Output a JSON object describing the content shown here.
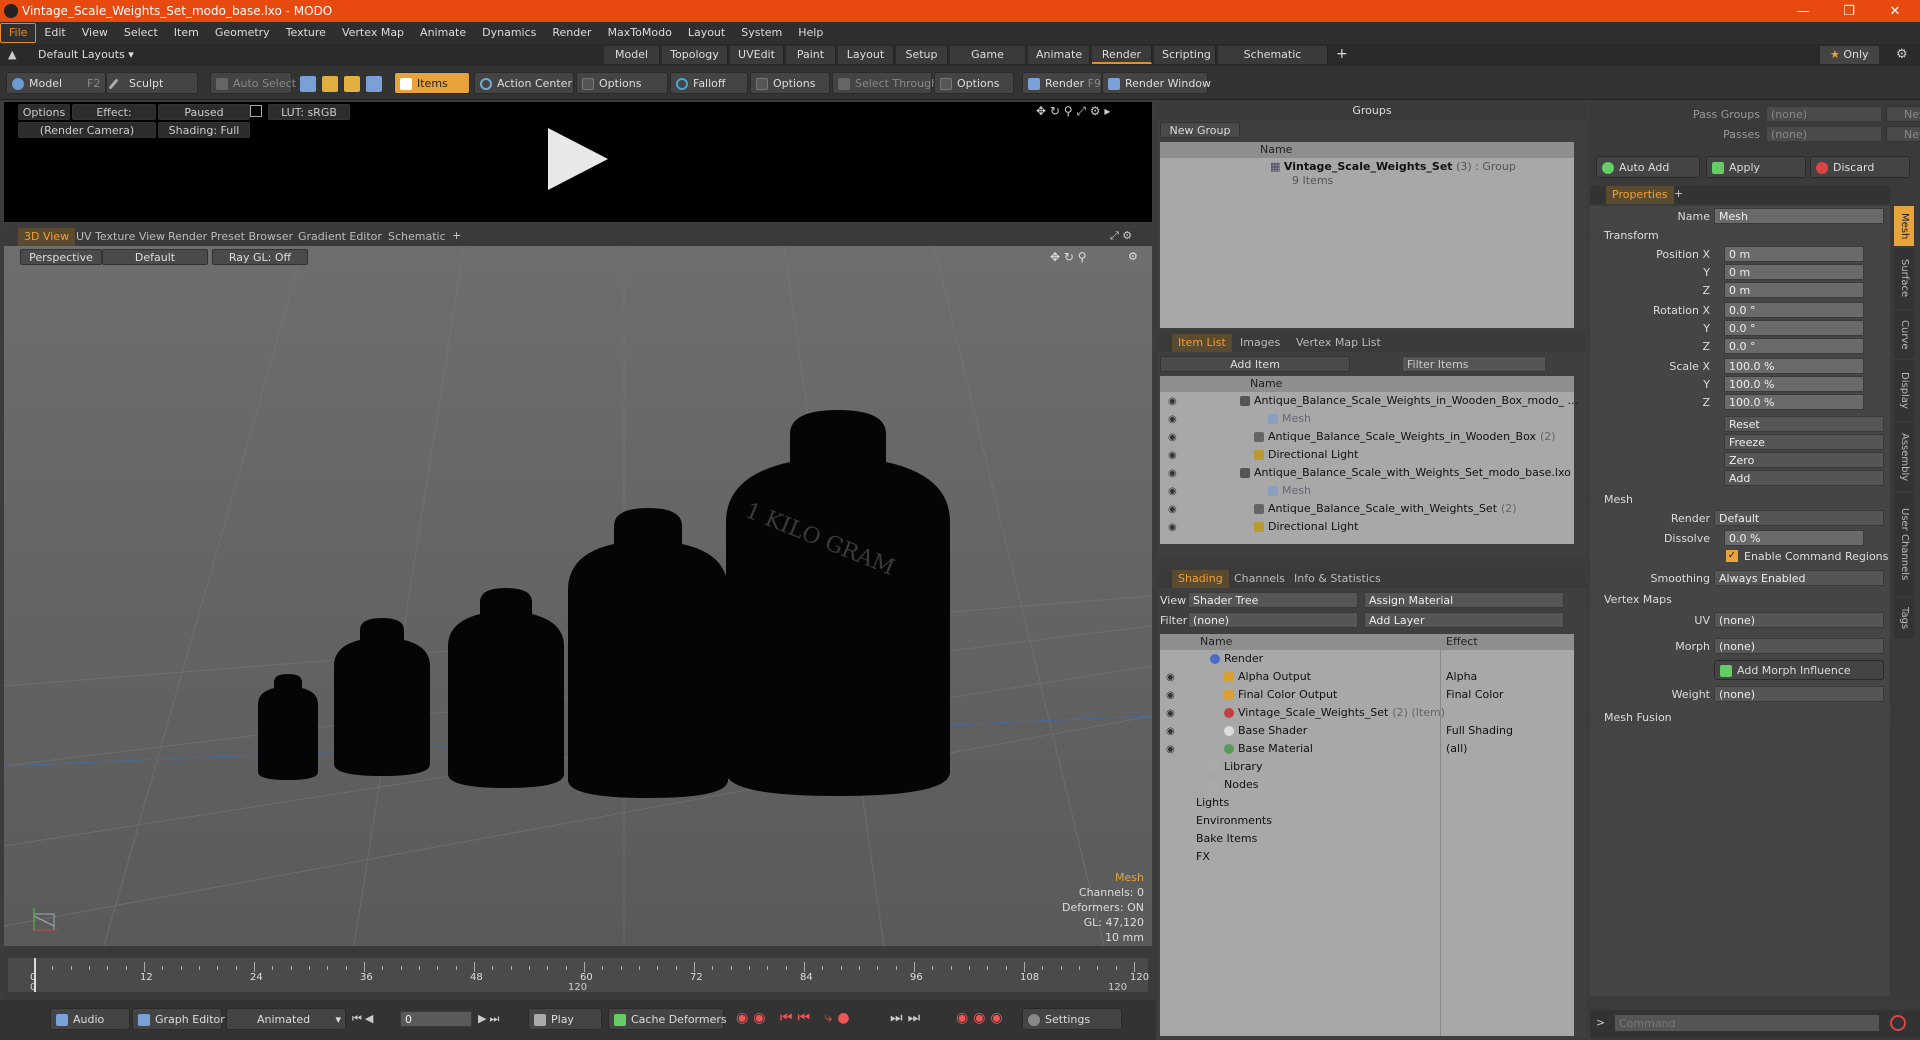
{
  "window": {
    "title": "Vintage_Scale_Weights_Set_modo_base.lxo - MODO"
  },
  "menu": [
    "File",
    "Edit",
    "View",
    "Select",
    "Item",
    "Geometry",
    "Texture",
    "Vertex Map",
    "Animate",
    "Dynamics",
    "Render",
    "MaxToModo",
    "Layout",
    "System",
    "Help"
  ],
  "layout": {
    "default_layouts": "Default Layouts ▾",
    "tabs": [
      "Model",
      "Topology",
      "UVEdit",
      "Paint",
      "Layout",
      "Setup",
      "Game Tools",
      "Animate",
      "Render",
      "Scripting",
      "Schematic Fusion"
    ],
    "active_tab": "Render",
    "only": "Only"
  },
  "toolbar": {
    "model": "Model",
    "model_key": "F2",
    "sculpt": "Sculpt",
    "auto_select": "Auto Select",
    "items": "Items",
    "action_center": "Action Center",
    "options1": "Options",
    "falloff": "Falloff",
    "options2": "Options",
    "select_through": "Select Through",
    "options3": "Options",
    "render": "Render",
    "render_key": "F9",
    "render_window": "Render Window"
  },
  "render_preview": {
    "options": "Options",
    "effect": "Effect: (Shadi...",
    "paused": "Paused",
    "lut": "LUT: sRGB",
    "camera": "(Render Camera)",
    "shading": "Shading: Full"
  },
  "viewport": {
    "tabs": [
      "3D View",
      "UV Texture View",
      "Render Preset Browser",
      "Gradient Editor",
      "Schematic"
    ],
    "perspective": "Perspective",
    "default": "Default",
    "raygl": "Ray GL: Off",
    "engraving": "1 KILO GRAM",
    "info": {
      "mesh": "Mesh",
      "channels": "Channels: 0",
      "deformers": "Deformers: ON",
      "gl": "GL: 47,120",
      "unit": "10 mm"
    }
  },
  "timeline": {
    "ticks": [
      "0",
      "12",
      "24",
      "36",
      "48",
      "60",
      "72",
      "84",
      "96",
      "108",
      "120"
    ],
    "sub_left": "0",
    "sub_mid": "120",
    "sub_right": "120"
  },
  "bottombar": {
    "audio": "Audio",
    "graph_editor": "Graph Editor",
    "animated": "Animated",
    "frame": "0",
    "play": "Play",
    "cache_deformers": "Cache Deformers",
    "settings": "Settings"
  },
  "groups": {
    "header": "Groups",
    "new_group": "New Group",
    "col_name": "Name",
    "item_name": "Vintage_Scale_Weights_Set",
    "item_count": "(3)",
    "item_type": ": Group",
    "item_sub": "9 Items"
  },
  "itemlist": {
    "tabs": [
      "Item List",
      "Images",
      "Vertex Map List"
    ],
    "add_item": "Add Item",
    "filter": "Filter Items",
    "col_name": "Name",
    "rows": [
      {
        "text": "Antique_Balance_Scale_Weights_in_Wooden_Box_modo_ ...",
        "indent": 0,
        "type": "scene"
      },
      {
        "text": "Mesh",
        "indent": 2,
        "type": "mesh"
      },
      {
        "text": "Antique_Balance_Scale_Weights_in_Wooden_Box",
        "suffix": "(2)",
        "indent": 1,
        "type": "group"
      },
      {
        "text": "Directional Light",
        "indent": 1,
        "type": "light"
      },
      {
        "text": "Antique_Balance_Scale_with_Weights_Set_modo_base.lxo",
        "indent": 0,
        "type": "scene"
      },
      {
        "text": "Mesh",
        "indent": 2,
        "type": "mesh"
      },
      {
        "text": "Antique_Balance_Scale_with_Weights_Set",
        "suffix": "(2)",
        "indent": 1,
        "type": "group"
      },
      {
        "text": "Directional Light",
        "indent": 1,
        "type": "light"
      }
    ]
  },
  "shading": {
    "tabs": [
      "Shading",
      "Channels",
      "Info & Statistics"
    ],
    "view_label": "View",
    "view_value": "Shader Tree",
    "assign_material": "Assign Material",
    "filter_label": "Filter",
    "filter_value": "(none)",
    "add_layer": "Add Layer",
    "col_name": "Name",
    "col_effect": "Effect",
    "rows": [
      {
        "name": "Render",
        "effect": "",
        "indent": 0
      },
      {
        "name": "Alpha Output",
        "effect": "Alpha",
        "indent": 1
      },
      {
        "name": "Final Color Output",
        "effect": "Final Color",
        "indent": 1
      },
      {
        "name": "Vintage_Scale_Weights_Set",
        "suffix": "(2) (Item)",
        "effect": "",
        "indent": 1
      },
      {
        "name": "Base Shader",
        "effect": "Full Shading",
        "indent": 1
      },
      {
        "name": "Base Material",
        "effect": "(all)",
        "indent": 1
      },
      {
        "name": "Library",
        "effect": "",
        "indent": 0
      },
      {
        "name": "Nodes",
        "effect": "",
        "indent": 0
      },
      {
        "name": "Lights",
        "effect": "",
        "indent": -1
      },
      {
        "name": "Environments",
        "effect": "",
        "indent": -1
      },
      {
        "name": "Bake Items",
        "effect": "",
        "indent": -1
      },
      {
        "name": "FX",
        "effect": "",
        "indent": -1
      }
    ]
  },
  "passes": {
    "pass_groups": "Pass Groups",
    "pass_groups_value": "(none)",
    "new": "New",
    "passes": "Passes",
    "passes_value": "(none)",
    "new2": "New",
    "auto_add": "Auto Add",
    "apply": "Apply",
    "discard": "Discard"
  },
  "properties": {
    "tab": "Properties",
    "name_label": "Name",
    "name_value": "Mesh",
    "transform": "Transform",
    "position_label": "Position X",
    "pos": [
      "0 m",
      "0 m",
      "0 m"
    ],
    "rotation_label": "Rotation X",
    "rot": [
      "0.0 °",
      "0.0 °",
      "0.0 °"
    ],
    "scale_label": "Scale X",
    "scale": [
      "100.0 %",
      "100.0 %",
      "100.0 %"
    ],
    "y": "Y",
    "z": "Z",
    "reset": "Reset",
    "freeze": "Freeze",
    "zero": "Zero",
    "add": "Add",
    "mesh_section": "Mesh",
    "render_label": "Render",
    "render_value": "Default",
    "dissolve_label": "Dissolve",
    "dissolve_value": "0.0 %",
    "enable_cmd": "Enable Command Regions",
    "smoothing_label": "Smoothing",
    "smoothing_value": "Always Enabled",
    "vertex_maps": "Vertex Maps",
    "uv_label": "UV",
    "uv_value": "(none)",
    "morph_label": "Morph",
    "morph_value": "(none)",
    "add_morph": "Add Morph Influence",
    "weight_label": "Weight",
    "weight_value": "(none)",
    "mesh_fusion": "Mesh Fusion",
    "side_tabs": [
      "Mesh",
      "Surface",
      "Curve",
      "Display",
      "Assembly",
      "User Channels",
      "Tags"
    ]
  },
  "command": {
    "placeholder": "Command"
  },
  "colors": {
    "accent": "#e88b2a",
    "title": "#e8490f"
  }
}
